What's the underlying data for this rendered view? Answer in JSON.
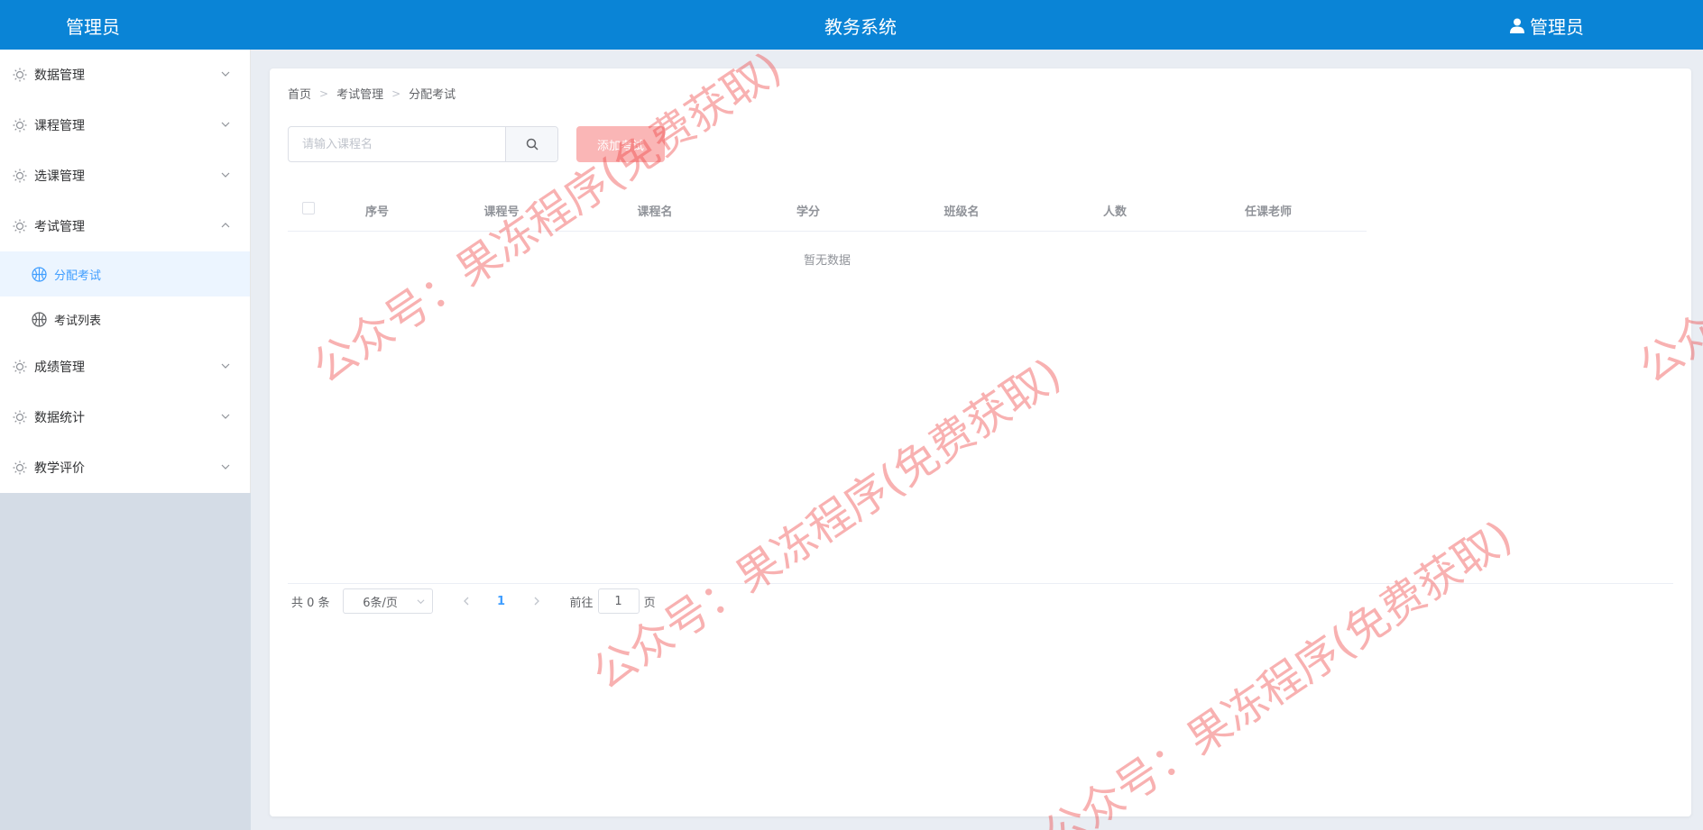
{
  "header": {
    "brand": "管理员",
    "title": "教务系统",
    "user": "管理员"
  },
  "sidebar": {
    "items": [
      {
        "label": "数据管理",
        "expanded": false
      },
      {
        "label": "课程管理",
        "expanded": false
      },
      {
        "label": "选课管理",
        "expanded": false
      },
      {
        "label": "考试管理",
        "expanded": true,
        "children": [
          {
            "label": "分配考试",
            "active": true
          },
          {
            "label": "考试列表",
            "active": false
          }
        ]
      },
      {
        "label": "成绩管理",
        "expanded": false
      },
      {
        "label": "数据统计",
        "expanded": false
      },
      {
        "label": "教学评价",
        "expanded": false
      }
    ]
  },
  "breadcrumb": [
    "首页",
    "考试管理",
    "分配考试"
  ],
  "search": {
    "placeholder": "请输入课程名",
    "value": ""
  },
  "toolbar": {
    "add_label": "添加考试"
  },
  "table": {
    "columns": [
      "序号",
      "课程号",
      "课程名",
      "学分",
      "班级名",
      "人数",
      "任课老师"
    ],
    "rows": [],
    "empty_text": "暂无数据"
  },
  "pagination": {
    "total_text": "共 0 条",
    "page_size": "6条/页",
    "current_page": "1",
    "goto_label": "前往",
    "goto_value": "1",
    "page_suffix": "页"
  },
  "watermark": {
    "text": "公众号：果冻程序(免费获取)"
  },
  "colors": {
    "header_bg": "#0a84d6",
    "accent": "#409eff",
    "add_button": "#fab6b6",
    "sidebar_bg": "#d4dce6",
    "watermark": "#ee4646"
  }
}
